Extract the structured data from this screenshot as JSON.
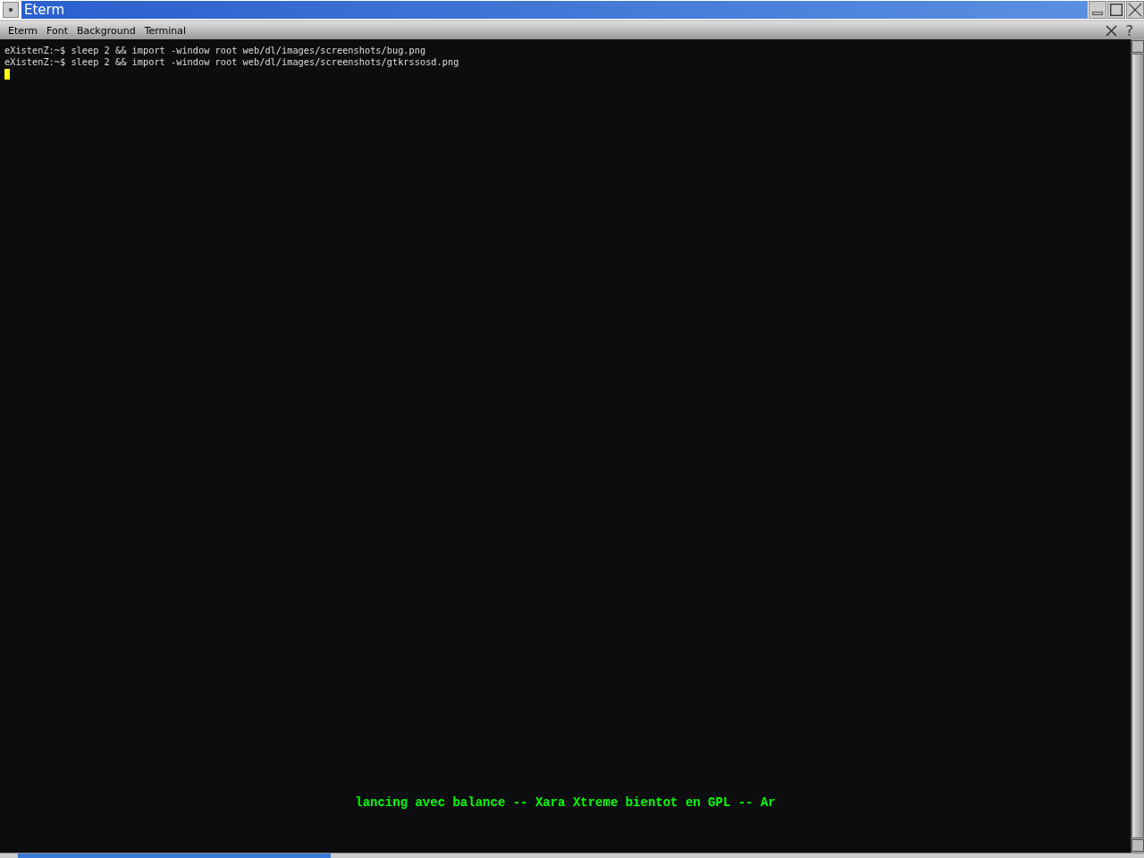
{
  "window": {
    "title": "Eterm"
  },
  "menu": [
    "Eterm",
    "Font",
    "Background",
    "Terminal"
  ],
  "help": "?",
  "terminal": {
    "lines": [
      {
        "prompt": "eXistenZ:~$",
        "command": "sleep 2 && import -window root web/dl/images/screenshots/bug.png"
      },
      {
        "prompt": "eXistenZ:~$",
        "command": "sleep 2 && import -window root web/dl/images/screenshots/gtkrssosd.png"
      }
    ]
  },
  "osd": "lancing avec balance -- Xara Xtreme bientot en GPL -- Ar"
}
